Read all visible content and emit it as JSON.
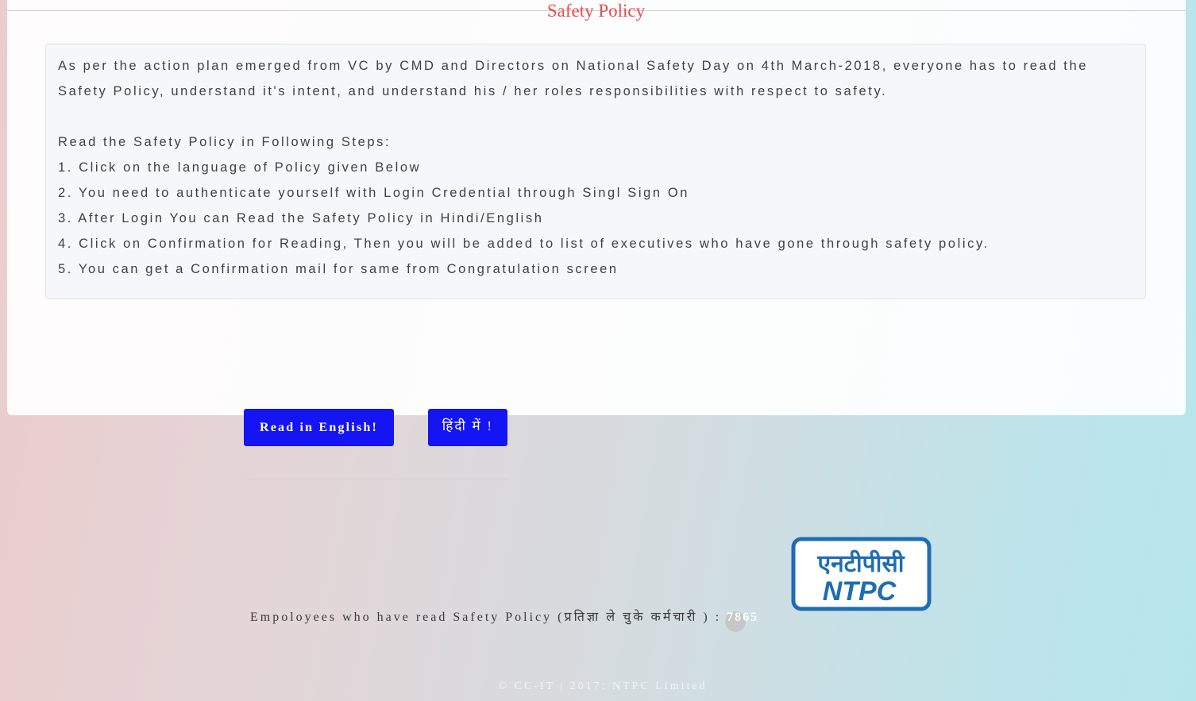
{
  "card": {
    "title": "Safety Policy"
  },
  "notice": {
    "intro_line1": "As per the action plan emerged from VC by CMD and Directors on National Safety Day on 4th March-2018, everyone has to read the",
    "intro_line2": "Safety Policy, understand it's intent, and understand his / her roles responsibilities with respect to safety.",
    "steps_heading": "Read the Safety Policy in Following Steps:",
    "steps": [
      "1. Click on the language of Policy given Below",
      "2. You need to authenticate yourself with Login Credential through Singl Sign On",
      "3. After Login You can Read the Safety Policy in Hindi/English",
      "4. Click on Confirmation for Reading, Then you will be added to list of executives who have gone through safety policy.",
      "5. You can get a Confirmation mail for same from Congratulation screen"
    ]
  },
  "buttons": {
    "english_label": "Read in English!",
    "hindi_label": "हिंदी में !"
  },
  "logo": {
    "hindi_text": "एनटीपीसी",
    "english_text": "NTPC",
    "color": "#1f6db3"
  },
  "counter": {
    "label": "Empoloyees who have read Safety Policy (प्रतिज्ञा ले चुके कर्मचारी ) : ",
    "value": "7865"
  },
  "footer": {
    "text": "© CC-IT | 2017: NTPC Limited"
  },
  "colors": {
    "title": "#e0504f",
    "button": "#1414f5",
    "logo": "#1f6db3"
  }
}
